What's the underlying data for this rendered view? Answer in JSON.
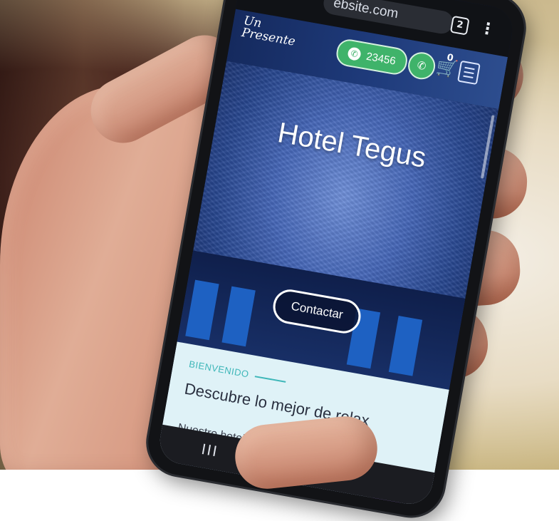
{
  "browser": {
    "url": "ebsite.com",
    "tab_count": "2",
    "menu_glyph": "⋮"
  },
  "header": {
    "logo_line1": "Un",
    "logo_line2": "Presente",
    "phone_number": "23456",
    "cart_count": "0",
    "icons": [
      "phone-icon",
      "whatsapp-icon",
      "cart-icon",
      "menu-icon"
    ]
  },
  "hero": {
    "title": "Hotel Tegus",
    "cta_label": "Contactar"
  },
  "welcome": {
    "kicker": "BIENVENIDO",
    "heading": "Descubre lo mejor de relax",
    "text": "Nuestro hotel en Tegus"
  },
  "navbar": {
    "recent_glyph": "III"
  },
  "colors": {
    "header_bg": "#1e3a7a",
    "whatsapp_green": "#3fb36a",
    "accent_teal": "#3fb7b9",
    "welcome_bg": "#dff2f7",
    "fab_purple": "#7d4fb7"
  }
}
